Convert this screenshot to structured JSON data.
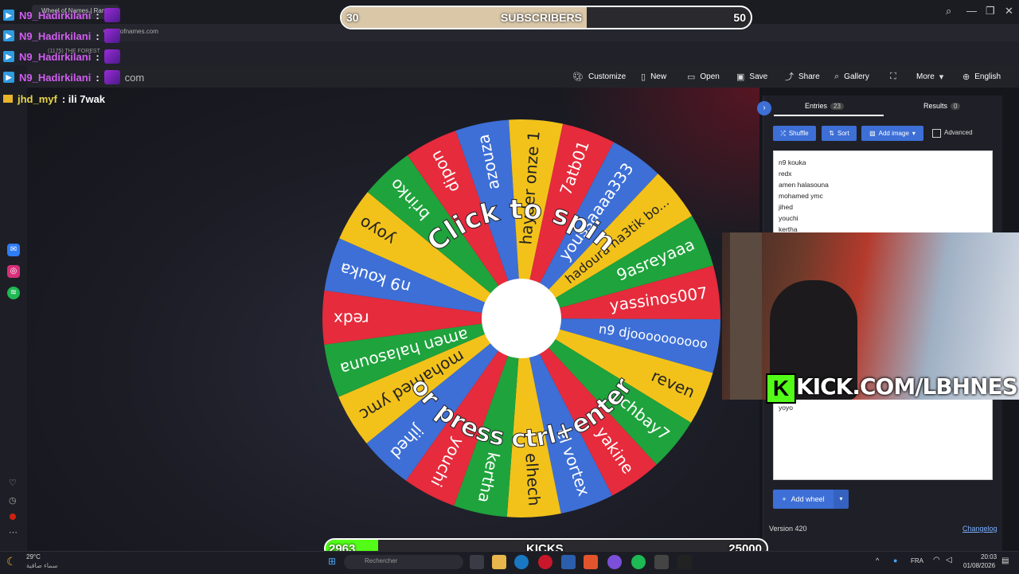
{
  "browser": {
    "tab_title": "Wheel of Names | Rando",
    "address": "wheelofnames.com",
    "bookmark": "(1175) THE FOREST",
    "extension_avatar": "c"
  },
  "chat": [
    {
      "user": "N9_Hadirkilani",
      "text": ":",
      "user_color": "#d05ef0"
    },
    {
      "user": "N9_Hadirkilani",
      "text": ":",
      "user_color": "#d05ef0"
    },
    {
      "user": "N9_Hadirkilani",
      "text": ":",
      "user_color": "#d05ef0"
    },
    {
      "user": "N9_Hadirkilani",
      "text": ":",
      "user_color": "#d05ef0"
    },
    {
      "user": "jhd_myf",
      "text": ": ili 7wak",
      "user_color": "#e7d64a"
    }
  ],
  "underlying_url": "com",
  "goal_subscribers": {
    "current": "30",
    "label": "SUBSCRIBERS",
    "target": "50",
    "progress": 0.6
  },
  "goal_kicks": {
    "current": "2963",
    "label": "KICKS",
    "target": "25000",
    "progress": 0.12
  },
  "toolbar": {
    "customize": "Customize",
    "new": "New",
    "open": "Open",
    "save": "Save",
    "share": "Share",
    "gallery": "Gallery",
    "more": "More",
    "language": "English"
  },
  "panel": {
    "entries_tab": "Entries",
    "entries_count": "23",
    "results_tab": "Results",
    "results_count": "0",
    "shuffle": "Shuffle",
    "sort": "Sort",
    "add_image": "Add image",
    "advanced": "Advanced",
    "entries_visible": [
      "n9 kouka",
      "redx",
      "amen halasouna",
      "mohamed ymc",
      "jihed",
      "youchi",
      "kertha"
    ],
    "entry_bottom": "yoyo",
    "add_wheel": "Add wheel",
    "version": "Version 420",
    "changelog": "Changelog"
  },
  "wheel": {
    "prompt_top": "Click to spin",
    "prompt_bottom": "or press ctrl+enter",
    "colors": [
      "#e52b3c",
      "#3d6fd6",
      "#f2c21b",
      "#1fa33c"
    ],
    "segments": [
      "7atb01",
      "youssaaaa333",
      "hadoura na3tik bo...",
      "9asreyaaa",
      "yassinos007",
      "n9 djoooooooooo",
      "reven",
      "chbay7",
      "yakine",
      "el vortex",
      "elhech",
      "kertha",
      "youchi",
      "jihed",
      "mohamed ymc",
      "amen halasouna",
      "redx",
      "n9 kouka",
      "yoyo",
      "brinko",
      "dipon",
      "azouza",
      "hayder onze 1"
    ]
  },
  "stream_overlay": {
    "kick_url": "KICK.COM/LBHNES"
  },
  "taskbar": {
    "weather_temp": "29°C",
    "weather_desc": "سماء صافية",
    "search_placeholder": "Rechercher",
    "lang": "FRA",
    "time": "20:03",
    "date": "01/08/2026"
  }
}
